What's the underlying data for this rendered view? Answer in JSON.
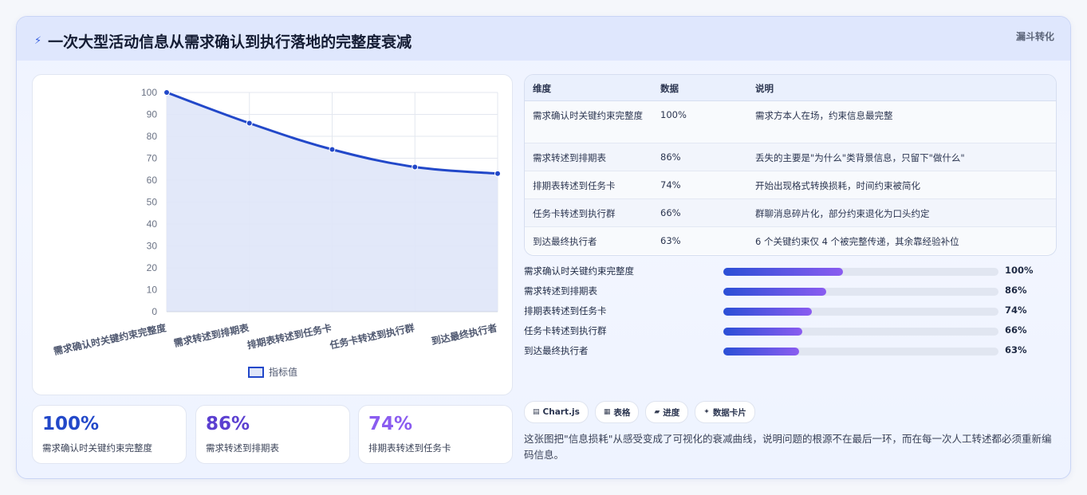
{
  "header": {
    "title": "一次大型活动信息从需求确认到执行落地的完整度衰减",
    "title_icon": "bolt-icon",
    "tag": "漏斗转化"
  },
  "chart_data": {
    "type": "line",
    "categories": [
      "需求确认时关键约束完整度",
      "需求转述到排期表",
      "排期表转述到任务卡",
      "任务卡转述到执行群",
      "到达最终执行者"
    ],
    "series": [
      {
        "name": "指标值",
        "values": [
          100,
          86,
          74,
          66,
          63
        ]
      }
    ],
    "ylim": [
      0,
      100
    ],
    "yticks": [
      0,
      10,
      20,
      30,
      40,
      50,
      60,
      70,
      80,
      90,
      100
    ],
    "grid": true,
    "legend": "bottom",
    "line_color": "#2248c9",
    "fill_color": "#dfe6f8"
  },
  "stats": [
    {
      "value": "100%",
      "label": "需求确认时关键约束完整度",
      "color": "#2248c9"
    },
    {
      "value": "86%",
      "label": "需求转述到排期表",
      "color": "#5b3fd0"
    },
    {
      "value": "74%",
      "label": "排期表转述到任务卡",
      "color": "#8a5cf0"
    }
  ],
  "table": {
    "headers": [
      "维度",
      "数据",
      "说明"
    ],
    "rows": [
      {
        "dim": "需求确认时关键约束完整度",
        "val": "100%",
        "desc": "需求方本人在场，约束信息最完整"
      },
      {
        "dim": "需求转述到排期表",
        "val": "86%",
        "desc": "丢失的主要是\"为什么\"类背景信息，只留下\"做什么\""
      },
      {
        "dim": "排期表转述到任务卡",
        "val": "74%",
        "desc": "开始出现格式转换损耗，时间约束被简化"
      },
      {
        "dim": "任务卡转述到执行群",
        "val": "66%",
        "desc": "群聊消息碎片化，部分约束退化为口头约定"
      },
      {
        "dim": "到达最终执行者",
        "val": "63%",
        "desc": "6 个关键约束仅 4 个被完整传递，其余靠经验补位"
      }
    ]
  },
  "progress": [
    {
      "label": "需求确认时关键约束完整度",
      "value": "100%",
      "fraction": 0.435
    },
    {
      "label": "需求转述到排期表",
      "value": "86%",
      "fraction": 0.374
    },
    {
      "label": "排期表转述到任务卡",
      "value": "74%",
      "fraction": 0.322
    },
    {
      "label": "任务卡转述到执行群",
      "value": "66%",
      "fraction": 0.287
    },
    {
      "label": "到达最终执行者",
      "value": "63%",
      "fraction": 0.274
    }
  ],
  "chips": [
    {
      "icon": "chart-icon",
      "glyph": "▤",
      "label": "Chart.js"
    },
    {
      "icon": "table-icon",
      "glyph": "▦",
      "label": "表格"
    },
    {
      "icon": "progress-icon",
      "glyph": "▰",
      "label": "进度"
    },
    {
      "icon": "card-icon",
      "glyph": "✦",
      "label": "数据卡片"
    }
  ],
  "note": "这张图把\"信息损耗\"从感受变成了可视化的衰减曲线，说明问题的根源不在最后一环，而在每一次人工转述都必须重新编码信息。"
}
